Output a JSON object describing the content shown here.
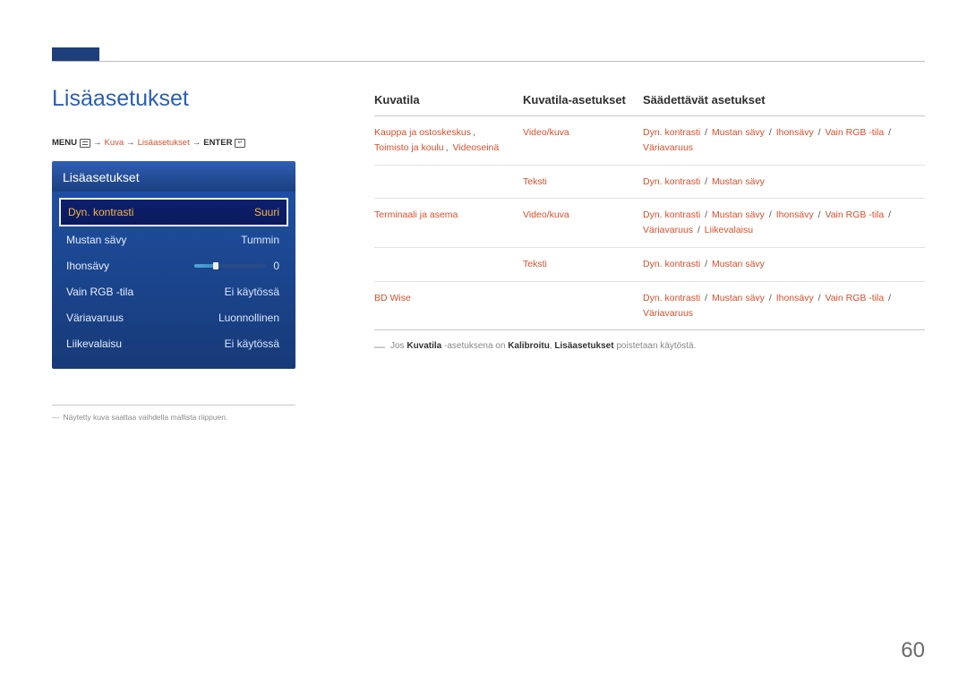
{
  "page": {
    "title": "Lisäasetukset",
    "number": "60"
  },
  "breadcrumb": {
    "menu": "MENU",
    "p1": "Kuva",
    "p2": "Lisäasetukset",
    "enter": "ENTER",
    "arrow": "→"
  },
  "osd": {
    "header": "Lisäasetukset",
    "rows": [
      {
        "label": "Dyn. kontrasti",
        "value": "Suuri",
        "selected": true
      },
      {
        "label": "Mustan sävy",
        "value": "Tummin"
      },
      {
        "label": "Ihonsävy",
        "value": "0",
        "slider": true
      },
      {
        "label": "Vain RGB -tila",
        "value": "Ei käytössä"
      },
      {
        "label": "Väriavaruus",
        "value": "Luonnollinen"
      },
      {
        "label": "Liikevalaisu",
        "value": "Ei käytössä"
      }
    ]
  },
  "left_footnote": {
    "dash": "―",
    "text": "Näytetty kuva saattaa vaihdella mallista riippuen."
  },
  "table": {
    "headers": {
      "c1": "Kuvatila",
      "c2": "Kuvatila-asetukset",
      "c3": "Säädettävät asetukset"
    },
    "rows": [
      {
        "c1": [
          "Kauppa ja ostoskeskus",
          ", ",
          "Toimisto ja koulu",
          ", ",
          "Videoseinä"
        ],
        "c2": "Video/kuva",
        "c3": [
          "Dyn. kontrasti",
          " / ",
          "Mustan sävy",
          " / ",
          "Ihonsävy",
          " / ",
          "Vain RGB -tila",
          " / ",
          "Väriavaruus"
        ]
      },
      {
        "c1": "",
        "c2": "Teksti",
        "c3": [
          "Dyn. kontrasti",
          " / ",
          "Mustan sävy"
        ]
      },
      {
        "c1": "Terminaali ja asema",
        "c2": "Video/kuva",
        "c3": [
          "Dyn. kontrasti",
          " / ",
          "Mustan sävy",
          " / ",
          "Ihonsävy",
          " / ",
          "Vain RGB -tila",
          " / ",
          "Väriavaruus",
          " / ",
          "Liikevalaisu"
        ]
      },
      {
        "c1": "",
        "c2": "Teksti",
        "c3": [
          "Dyn. kontrasti",
          " / ",
          "Mustan sävy"
        ]
      },
      {
        "c1": "BD Wise",
        "c2": "",
        "c3": [
          "Dyn. kontrasti",
          " / ",
          "Mustan sävy",
          " / ",
          "Ihonsävy",
          " / ",
          "Vain RGB -tila",
          " / ",
          "Väriavaruus"
        ]
      }
    ]
  },
  "note": {
    "dash": "―",
    "pre": "Jos ",
    "b1": "Kuvatila",
    "mid1": " -asetuksena on ",
    "b2": "Kalibroitu",
    "mid2": ", ",
    "b3": "Lisäasetukset",
    "post": " poistetaan käytöstä."
  }
}
